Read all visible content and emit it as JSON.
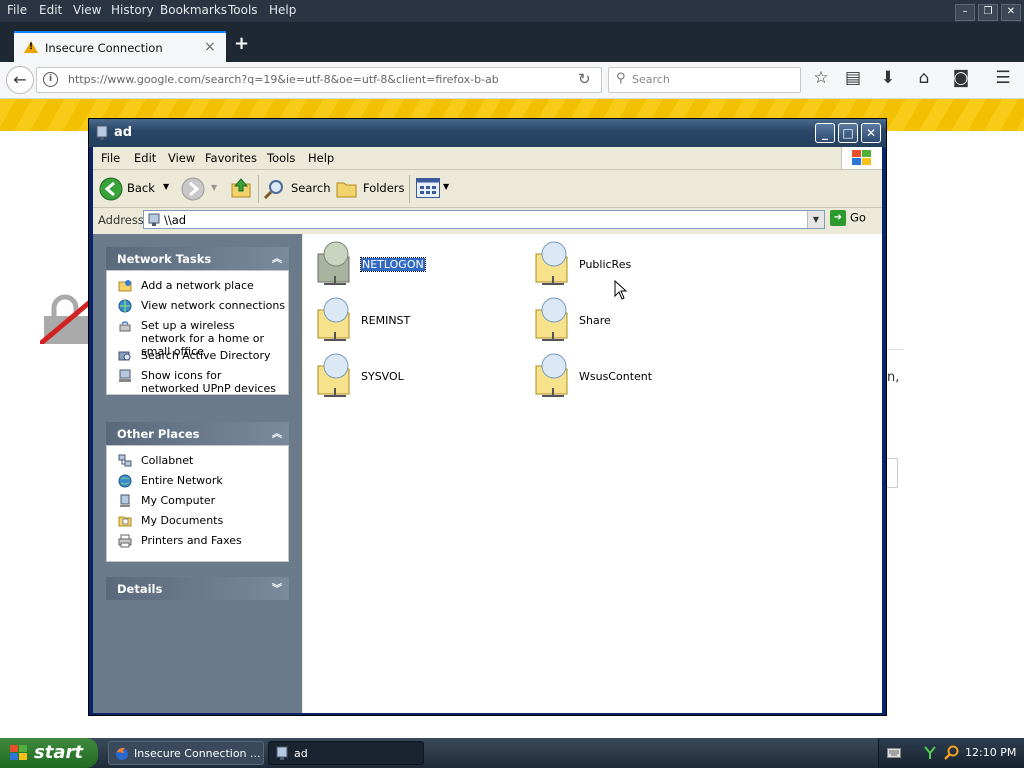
{
  "firefox": {
    "menu": [
      "File",
      "Edit",
      "View",
      "History",
      "Bookmarks",
      "Tools",
      "Help"
    ],
    "tab_title": "Insecure Connection",
    "url": "https://www.google.com/search?q=19&ie=utf-8&oe=utf-8&client=firefox-b-ab",
    "search_placeholder": "Search"
  },
  "explorer": {
    "title": "ad",
    "menu": [
      "File",
      "Edit",
      "View",
      "Favorites",
      "Tools",
      "Help"
    ],
    "toolbar": {
      "back": "Back",
      "search": "Search",
      "folders": "Folders"
    },
    "address_label": "Address",
    "address_value": "\\\\ad",
    "go_label": "Go",
    "network_tasks": {
      "title": "Network Tasks",
      "items": [
        {
          "label": "Add a network place"
        },
        {
          "label": "View network connections"
        },
        {
          "label": "Set up a wireless network for a home or small office"
        },
        {
          "label": "Search Active Directory"
        },
        {
          "label": "Show icons for networked UPnP devices"
        }
      ]
    },
    "other_places": {
      "title": "Other Places",
      "items": [
        {
          "label": "Collabnet"
        },
        {
          "label": "Entire Network"
        },
        {
          "label": "My Computer"
        },
        {
          "label": "My Documents"
        },
        {
          "label": "Printers and Faxes"
        }
      ]
    },
    "details": {
      "title": "Details"
    },
    "shares": [
      {
        "name": "NETLOGON",
        "selected": true
      },
      {
        "name": "PublicRes"
      },
      {
        "name": "REMINST"
      },
      {
        "name": "Share"
      },
      {
        "name": "SYSVOL"
      },
      {
        "name": "WsusContent"
      }
    ]
  },
  "taskbar": {
    "start_label": "start",
    "buttons": [
      {
        "label": "Insecure Connection ..."
      },
      {
        "label": "ad"
      }
    ],
    "clock": "12:10 PM"
  },
  "colors": {
    "warning_stripe": "#f2c000",
    "xp_title_blue": "#2b4768",
    "selection": "#316ac5",
    "start_green": "#3f8a3f"
  }
}
